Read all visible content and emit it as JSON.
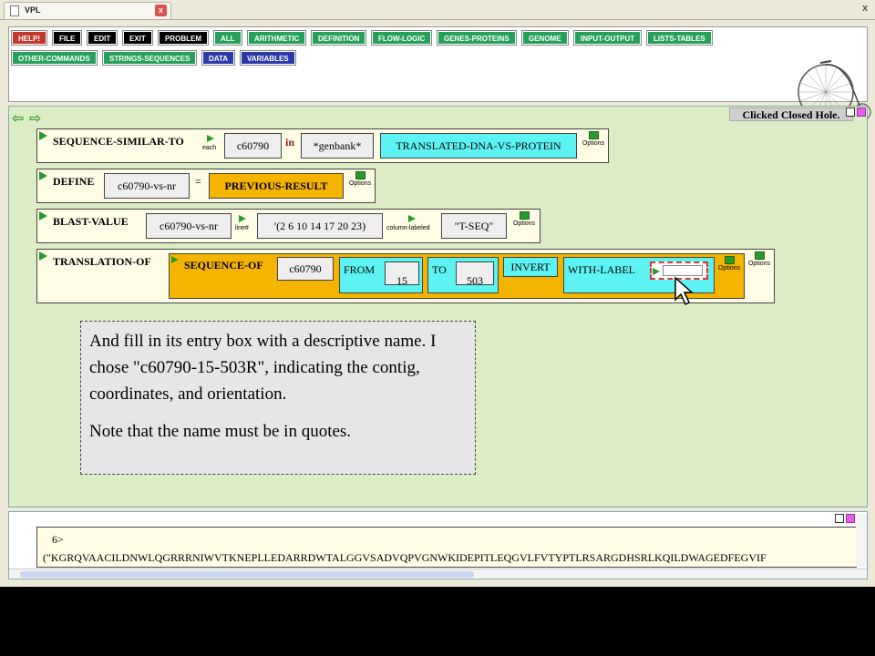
{
  "window": {
    "tab_title": "VPL",
    "tab_close": "x",
    "close_glyph": "x"
  },
  "menu": {
    "row1": [
      {
        "label": "HELP!",
        "color": "#c0392b"
      },
      {
        "label": "FILE",
        "color": "#000000"
      },
      {
        "label": "EDIT",
        "color": "#000000"
      },
      {
        "label": "EXIT",
        "color": "#000000"
      },
      {
        "label": "PROBLEM",
        "color": "#000000"
      },
      {
        "label": "ALL",
        "color": "#27a05a"
      },
      {
        "label": "ARITHMETIC",
        "color": "#27a05a"
      },
      {
        "label": "DEFINITION",
        "color": "#27a05a"
      },
      {
        "label": "FLOW-LOGIC",
        "color": "#27a05a"
      },
      {
        "label": "GENES-PROTEINS",
        "color": "#27a05a"
      },
      {
        "label": "GENOME",
        "color": "#27a05a"
      },
      {
        "label": "INPUT-OUTPUT",
        "color": "#27a05a"
      },
      {
        "label": "LISTS-TABLES",
        "color": "#27a05a"
      }
    ],
    "row2": [
      {
        "label": "OTHER-COMMANDS",
        "color": "#27a05a"
      },
      {
        "label": "STRINGS-SEQUENCES",
        "color": "#27a05a"
      },
      {
        "label": "DATA",
        "color": "#2a3aa8"
      },
      {
        "label": "VARIABLES",
        "color": "#2a3aa8"
      }
    ]
  },
  "workspace": {
    "status": "Clicked Closed Hole.",
    "back_arrow": "⇦",
    "fwd_arrow": "⇨",
    "row1": {
      "keyword": "SEQUENCE-SIMILAR-TO",
      "each": "each",
      "arg1": "c60790",
      "in": "in",
      "arg2": "*genbank*",
      "arg3": "TRANSLATED-DNA-VS-PROTEIN",
      "options": "Options"
    },
    "row2": {
      "keyword": "DEFINE",
      "arg1": "c60790-vs-nr",
      "eq": "=",
      "arg2": "PREVIOUS-RESULT",
      "options": "Options"
    },
    "row3": {
      "keyword": "BLAST-VALUE",
      "arg1": "c60790-vs-nr",
      "line": "line#",
      "arg2": "'(2 6 10 14 17 20 23)",
      "col": "column-labeled",
      "arg3": "\"T-SEQ\"",
      "options": "Options"
    },
    "row4": {
      "keyword": "TRANSLATION-OF",
      "inner_kw": "SEQUENCE-OF",
      "seq": "c60790",
      "from": "FROM",
      "from_val": "15",
      "to": "TO",
      "to_val": "503",
      "invert": "INVERT",
      "with_label": "WITH-LABEL",
      "label_val": "",
      "options_inner": "Options",
      "options_outer": "Options"
    }
  },
  "note": {
    "p1": "And fill in its entry box with a descriptive name. I chose \"c60790-15-503R\", indicating the contig, coordinates, and orientation.",
    "p2": "Note that the name must be in quotes."
  },
  "output": {
    "prompt": "6>",
    "text": "(\"KGRQVAACILDNWLQGRRRNIWVTKNEPLLEDARRDWTALGGVSADVQPVGNWKIDEPITLEQGVLFVTYPTLRSARGDHSRLKQILDWAGEDFEGVIF"
  },
  "colors": {
    "workspace_bg": "#dcecc5",
    "cyan": "#5ef3f3",
    "orange": "#f4b400"
  }
}
